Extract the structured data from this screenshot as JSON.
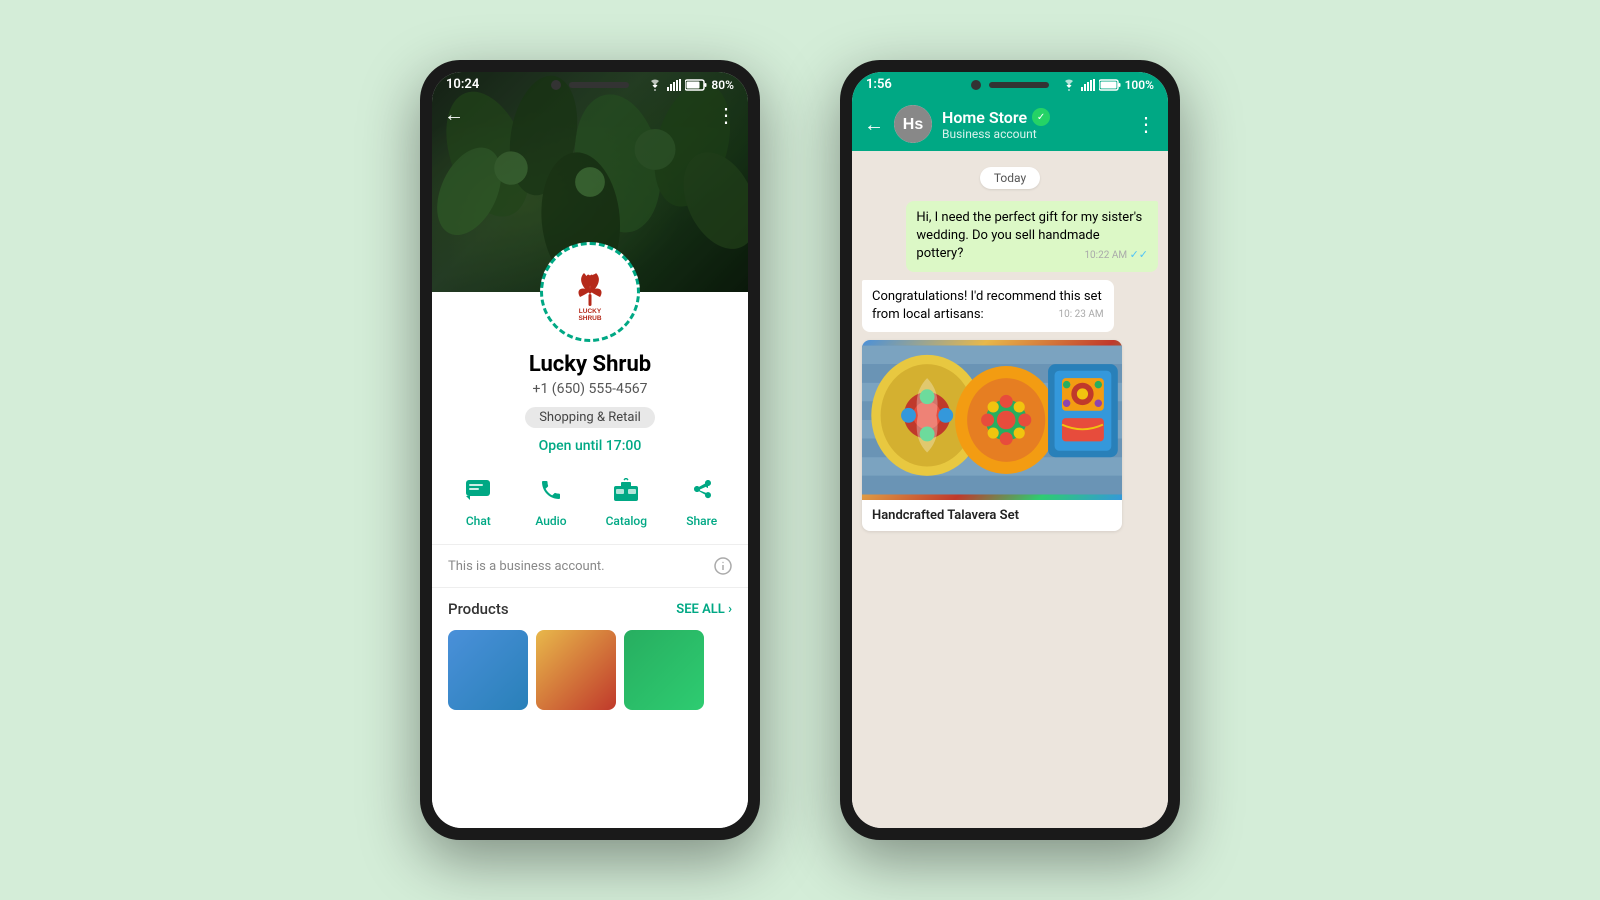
{
  "background": "#d4edd8",
  "phone1": {
    "status_bar": {
      "time": "10:24",
      "battery": "80%"
    },
    "business_name": "Lucky Shrub",
    "phone": "+1 (650) 555-4567",
    "category": "Shopping & Retail",
    "open_status": "Open until 17:00",
    "actions": [
      {
        "id": "chat",
        "label": "Chat",
        "icon": "💬"
      },
      {
        "id": "audio",
        "label": "Audio",
        "icon": "📞"
      },
      {
        "id": "catalog",
        "label": "Catalog",
        "icon": "🏪"
      },
      {
        "id": "share",
        "label": "Share",
        "icon": "↗"
      }
    ],
    "business_note": "This is a business account.",
    "products_label": "Products",
    "see_all": "SEE ALL"
  },
  "phone2": {
    "status_bar": {
      "time": "1:56",
      "battery": "100%"
    },
    "chat_name": "Home Store",
    "chat_subtitle": "Business account",
    "date_divider": "Today",
    "messages": [
      {
        "id": "msg1",
        "type": "sent",
        "text": "Hi, I need the perfect gift for my sister's wedding. Do you sell handmade pottery?",
        "time": "10:22 AM",
        "ticks": true
      },
      {
        "id": "msg2",
        "type": "received",
        "text": "Congratulations! I'd recommend this set from local artisans:",
        "time": "10: 23 AM"
      }
    ],
    "product": {
      "name": "Handcrafted Talavera Set"
    }
  }
}
